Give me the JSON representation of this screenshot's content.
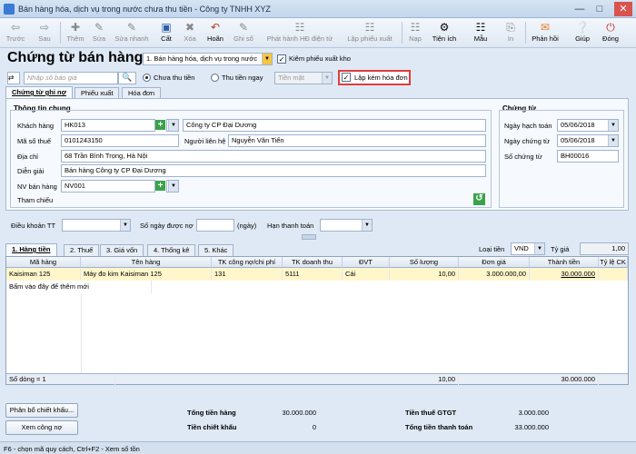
{
  "window": {
    "title": "Bán hàng hóa, dịch vụ trong nước chưa thu tiền - Công ty TNHH XYZ"
  },
  "toolbar": {
    "prev": "Trước",
    "next": "Sau",
    "add": "Thêm",
    "edit": "Sửa",
    "quick_edit": "Sửa nhanh",
    "save": "Cất",
    "delete": "Xóa",
    "undo": "Hoãn",
    "record": "Ghi sổ",
    "issue_einvoice": "Phát hành HĐ điện tử",
    "create_export": "Lập phiếu xuất",
    "load": "Nạp",
    "utilities": "Tiện ích",
    "template": "Mẫu",
    "print": "In",
    "feedback": "Phản hồi",
    "help": "Giúp",
    "close": "Đóng"
  },
  "page": {
    "title": "Chứng từ bán hàng",
    "sale_type": "1. Bán hàng hóa, dịch vụ trong nước",
    "export_check_label": "Kiêm phiếu xuất kho",
    "quote_placeholder": "Nhập số báo giá",
    "payment_unpaid": "Chưa thu tiền",
    "payment_immediate": "Thu tiền ngay",
    "payment_method": "Tiền mặt",
    "create_invoice_label": "Lập kèm hóa đơn"
  },
  "tabs": {
    "voucher": "Chứng từ ghi nợ",
    "export": "Phiếu xuất",
    "invoice": "Hóa đơn"
  },
  "general": {
    "section": "Thông tin chung",
    "customer_label": "Khách hàng",
    "customer_code": "HK013",
    "customer_name": "Công ty CP Đại Dương",
    "tax_label": "Mã số thuế",
    "tax_code": "0101243150",
    "contact_label": "Người liên hệ",
    "contact": "Nguyễn Văn Tiến",
    "address_label": "Địa chỉ",
    "address": "68 Trần Bình Trọng, Hà Nội",
    "desc_label": "Diễn giải",
    "desc": "Bán hàng Công ty CP Đại Dương",
    "staff_label": "NV bán hàng",
    "staff": "NV001",
    "ref_label": "Tham chiếu"
  },
  "voucher": {
    "section": "Chứng từ",
    "posting_label": "Ngày hạch toán",
    "posting_date": "05/06/2018",
    "voucher_date_label": "Ngày chứng từ",
    "voucher_date": "05/06/2018",
    "number_label": "Số chứng từ",
    "number": "BH00016"
  },
  "terms": {
    "term_label": "Điều khoản TT",
    "term": "",
    "days_label": "Số ngày được nợ",
    "days": "",
    "days_unit": "(ngày)",
    "due_label": "Hạn thanh toán",
    "due": ""
  },
  "detail_tabs": {
    "t1": "1. Hàng tiền",
    "t2": "2. Thuế",
    "t3": "3. Giá vốn",
    "t4": "4. Thống kê",
    "t5": "5. Khác"
  },
  "currency": {
    "label": "Loại tiền",
    "value": "VND",
    "rate_label": "Tỷ giá",
    "rate": "1,00"
  },
  "grid": {
    "headers": [
      "Mã hàng",
      "Tên hàng",
      "TK công nợ/chi phí",
      "TK doanh thu",
      "ĐVT",
      "Số lượng",
      "Đơn giá",
      "Thành tiền",
      "Tỷ lệ CK"
    ],
    "row": {
      "code": "Kaisiman 125",
      "name": "Máy đo kim Kaisiman 125",
      "debit_acc": "131",
      "revenue_acc": "5111",
      "unit": "Cái",
      "qty": "10,00",
      "price": "3.000.000,00",
      "amount": "30.000.000"
    },
    "add_row": "Bấm vào đây để thêm mới",
    "row_count": "Số dòng = 1",
    "total_qty": "10,00",
    "total_amount": "30.000.000"
  },
  "footer": {
    "discount_btn": "Phân bổ chiết khấu...",
    "debt_btn": "Xem công nợ",
    "total_goods_label": "Tổng tiền hàng",
    "total_goods": "30.000.000",
    "discount_label": "Tiền chiết khấu",
    "discount": "0",
    "vat_label": "Tiền thuế GTGT",
    "vat": "3.000.000",
    "pay_label": "Tổng tiền thanh toán",
    "pay": "33.000.000",
    "status": "F6 - chọn mã quy cách, Ctrl+F2 - Xem số tồn"
  }
}
